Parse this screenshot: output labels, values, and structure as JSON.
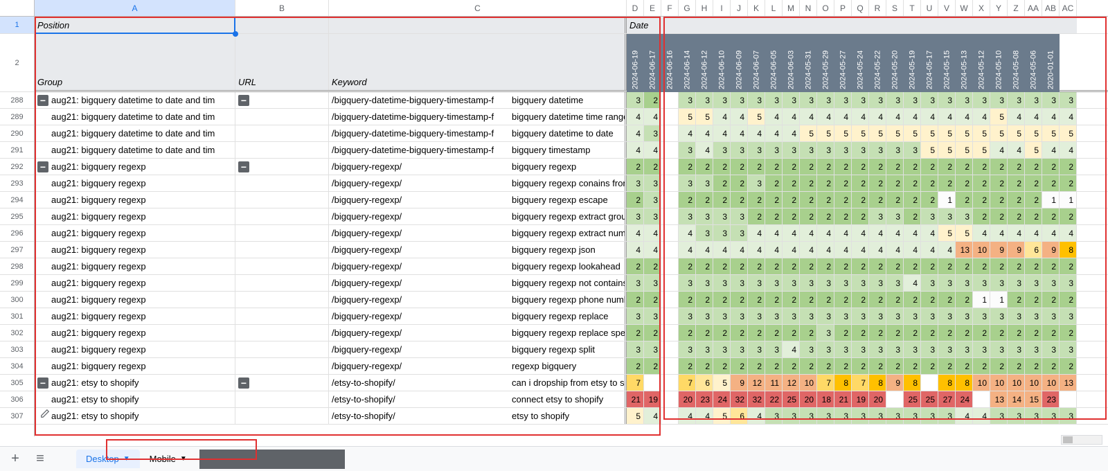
{
  "columns": [
    "A",
    "B",
    "C",
    "D",
    "E",
    "F",
    "G",
    "H",
    "I",
    "J",
    "K",
    "L",
    "M",
    "N",
    "O",
    "P",
    "Q",
    "R",
    "S",
    "T",
    "U",
    "V",
    "W",
    "X",
    "Y",
    "Z",
    "AA",
    "AB",
    "AC"
  ],
  "header_row": {
    "position_label": "Position",
    "date_label": "Date",
    "group_label": "Group",
    "url_label": "URL",
    "keyword_label": "Keyword"
  },
  "dates": [
    "2024-06-19",
    "2024-06-17",
    "2024-06-16",
    "2024-06-14",
    "2024-06-12",
    "2024-06-10",
    "2024-06-09",
    "2024-06-07",
    "2024-06-05",
    "2024-06-03",
    "2024-05-31",
    "2024-05-29",
    "2024-05-27",
    "2024-05-24",
    "2024-05-22",
    "2024-05-20",
    "2024-05-19",
    "2024-05-17",
    "2024-05-15",
    "2024-05-13",
    "2024-05-12",
    "2024-05-10",
    "2024-05-08",
    "2024-05-06",
    "2020-01-01"
  ],
  "row_numbers": [
    "1",
    "2",
    "288",
    "289",
    "290",
    "291",
    "292",
    "293",
    "294",
    "295",
    "296",
    "297",
    "298",
    "299",
    "300",
    "301",
    "302",
    "303",
    "304",
    "305",
    "306",
    "307"
  ],
  "rows": [
    {
      "n": "288",
      "group": "aug21: bigquery datetime to date and tim",
      "url": "/bigquery-datetime-bigquery-timestamp-f",
      "keyword": "bigquery datetime",
      "collapse": true,
      "values": [
        3,
        2,
        null,
        3,
        3,
        3,
        3,
        3,
        3,
        3,
        3,
        3,
        3,
        3,
        3,
        3,
        3,
        3,
        3,
        3,
        3,
        3,
        3,
        3,
        3,
        3
      ]
    },
    {
      "n": "289",
      "group": "aug21: bigquery datetime to date and tim",
      "url": "/bigquery-datetime-bigquery-timestamp-f",
      "keyword": "bigquery datetime time range",
      "values": [
        4,
        4,
        null,
        5,
        5,
        4,
        4,
        5,
        4,
        4,
        4,
        4,
        4,
        4,
        4,
        4,
        4,
        4,
        4,
        4,
        4,
        5,
        4,
        4,
        4,
        4
      ]
    },
    {
      "n": "290",
      "group": "aug21: bigquery datetime to date and tim",
      "url": "/bigquery-datetime-bigquery-timestamp-f",
      "keyword": "bigquery datetime to date",
      "values": [
        4,
        3,
        null,
        4,
        4,
        4,
        4,
        4,
        4,
        4,
        5,
        5,
        5,
        5,
        5,
        5,
        5,
        5,
        5,
        5,
        5,
        5,
        5,
        5,
        5,
        5
      ]
    },
    {
      "n": "291",
      "group": "aug21: bigquery datetime to date and tim",
      "url": "/bigquery-datetime-bigquery-timestamp-f",
      "keyword": "bigquery timestamp",
      "values": [
        4,
        4,
        null,
        3,
        4,
        3,
        3,
        3,
        3,
        3,
        3,
        3,
        3,
        3,
        3,
        3,
        3,
        5,
        5,
        5,
        5,
        4,
        4,
        5,
        4,
        4
      ]
    },
    {
      "n": "292",
      "group": "aug21: bigquery regexp",
      "url": "/bigquery-regexp/",
      "keyword": "bigquery regexp",
      "collapse": true,
      "values": [
        2,
        2,
        null,
        2,
        2,
        2,
        2,
        2,
        2,
        2,
        2,
        2,
        2,
        2,
        2,
        2,
        2,
        2,
        2,
        2,
        2,
        2,
        2,
        2,
        2,
        2
      ]
    },
    {
      "n": "293",
      "group": "aug21: bigquery regexp",
      "url": "/bigquery-regexp/",
      "keyword": "bigquery regexp conains from another colum",
      "values": [
        3,
        3,
        null,
        3,
        3,
        2,
        2,
        3,
        2,
        2,
        2,
        2,
        2,
        2,
        2,
        2,
        2,
        2,
        2,
        2,
        2,
        2,
        2,
        2,
        2,
        2
      ]
    },
    {
      "n": "294",
      "group": "aug21: bigquery regexp",
      "url": "/bigquery-regexp/",
      "keyword": "bigquery regexp escape",
      "values": [
        2,
        3,
        null,
        2,
        2,
        2,
        2,
        2,
        2,
        2,
        2,
        2,
        2,
        2,
        2,
        2,
        2,
        2,
        1,
        2,
        2,
        2,
        2,
        2,
        1,
        1
      ]
    },
    {
      "n": "295",
      "group": "aug21: bigquery regexp",
      "url": "/bigquery-regexp/",
      "keyword": "bigquery regexp extract group",
      "values": [
        3,
        3,
        null,
        3,
        3,
        3,
        3,
        2,
        2,
        2,
        2,
        2,
        2,
        2,
        3,
        3,
        2,
        3,
        3,
        3,
        2,
        2,
        2,
        2,
        2,
        2
      ]
    },
    {
      "n": "296",
      "group": "aug21: bigquery regexp",
      "url": "/bigquery-regexp/",
      "keyword": "bigquery regexp extract number from string",
      "values": [
        4,
        4,
        null,
        4,
        3,
        3,
        3,
        4,
        4,
        4,
        4,
        4,
        4,
        4,
        4,
        4,
        4,
        4,
        5,
        5,
        4,
        4,
        4,
        4,
        4,
        4
      ]
    },
    {
      "n": "297",
      "group": "aug21: bigquery regexp",
      "url": "/bigquery-regexp/",
      "keyword": "bigquery regexp json",
      "values": [
        4,
        4,
        null,
        4,
        4,
        4,
        4,
        4,
        4,
        4,
        4,
        4,
        4,
        4,
        4,
        4,
        4,
        4,
        4,
        13,
        10,
        9,
        9,
        6,
        9,
        8
      ]
    },
    {
      "n": "298",
      "group": "aug21: bigquery regexp",
      "url": "/bigquery-regexp/",
      "keyword": "bigquery regexp lookahead",
      "values": [
        2,
        2,
        null,
        2,
        2,
        2,
        2,
        2,
        2,
        2,
        2,
        2,
        2,
        2,
        2,
        2,
        2,
        2,
        2,
        2,
        2,
        2,
        2,
        2,
        2,
        2
      ]
    },
    {
      "n": "299",
      "group": "aug21: bigquery regexp",
      "url": "/bigquery-regexp/",
      "keyword": "bigquery regexp not contains",
      "values": [
        3,
        3,
        null,
        3,
        3,
        3,
        3,
        3,
        3,
        3,
        3,
        3,
        3,
        3,
        3,
        3,
        4,
        3,
        3,
        3,
        3,
        3,
        3,
        3,
        3,
        3
      ]
    },
    {
      "n": "300",
      "group": "aug21: bigquery regexp",
      "url": "/bigquery-regexp/",
      "keyword": "bigquery regexp phone number",
      "values": [
        2,
        2,
        null,
        2,
        2,
        2,
        2,
        2,
        2,
        2,
        2,
        2,
        2,
        2,
        2,
        2,
        2,
        2,
        2,
        2,
        1,
        1,
        2,
        2,
        2,
        2
      ]
    },
    {
      "n": "301",
      "group": "aug21: bigquery regexp",
      "url": "/bigquery-regexp/",
      "keyword": "bigquery regexp replace",
      "values": [
        3,
        3,
        null,
        3,
        3,
        3,
        3,
        3,
        3,
        3,
        3,
        3,
        3,
        3,
        3,
        3,
        3,
        3,
        3,
        3,
        3,
        3,
        3,
        3,
        3,
        3
      ]
    },
    {
      "n": "302",
      "group": "aug21: bigquery regexp",
      "url": "/bigquery-regexp/",
      "keyword": "bigquery regexp replace special characters",
      "values": [
        2,
        2,
        null,
        2,
        2,
        2,
        2,
        2,
        2,
        2,
        2,
        3,
        2,
        2,
        2,
        2,
        2,
        2,
        2,
        2,
        2,
        2,
        2,
        2,
        2,
        2
      ]
    },
    {
      "n": "303",
      "group": "aug21: bigquery regexp",
      "url": "/bigquery-regexp/",
      "keyword": "bigquery regexp split",
      "values": [
        3,
        3,
        null,
        3,
        3,
        3,
        3,
        3,
        3,
        4,
        3,
        3,
        3,
        3,
        3,
        3,
        3,
        3,
        3,
        3,
        3,
        3,
        3,
        3,
        3,
        3
      ]
    },
    {
      "n": "304",
      "group": "aug21: bigquery regexp",
      "url": "/bigquery-regexp/",
      "keyword": "regexp bigquery",
      "values": [
        2,
        2,
        null,
        2,
        2,
        2,
        2,
        2,
        2,
        2,
        2,
        2,
        2,
        2,
        2,
        2,
        2,
        2,
        2,
        2,
        2,
        2,
        2,
        2,
        2,
        2
      ]
    },
    {
      "n": "305",
      "group": "aug21: etsy to shopify",
      "url": "/etsy-to-shopify/",
      "keyword": "can i dropship from etsy to shopify",
      "collapse": true,
      "values": [
        7,
        null,
        null,
        7,
        6,
        5,
        9,
        12,
        11,
        12,
        10,
        7,
        8,
        7,
        8,
        9,
        8,
        null,
        8,
        8,
        10,
        10,
        10,
        10,
        10,
        13
      ]
    },
    {
      "n": "306",
      "group": "aug21: etsy to shopify",
      "url": "/etsy-to-shopify/",
      "keyword": "connect etsy to shopify",
      "values": [
        21,
        19,
        null,
        20,
        23,
        24,
        32,
        32,
        22,
        25,
        20,
        18,
        21,
        19,
        20,
        null,
        25,
        25,
        27,
        24,
        null,
        13,
        14,
        15,
        23,
        null
      ]
    },
    {
      "n": "307",
      "group": "aug21: etsy to shopify",
      "url": "/etsy-to-shopify/",
      "keyword": "etsy to shopify",
      "values": [
        5,
        4,
        null,
        4,
        4,
        5,
        6,
        4,
        3,
        3,
        3,
        3,
        3,
        3,
        3,
        3,
        3,
        3,
        3,
        4,
        4,
        3,
        3,
        3,
        3,
        3
      ]
    }
  ],
  "tabs": {
    "desktop": "Desktop",
    "mobile": "Mobile"
  },
  "icons": {
    "add": "+",
    "menu": "≡"
  }
}
